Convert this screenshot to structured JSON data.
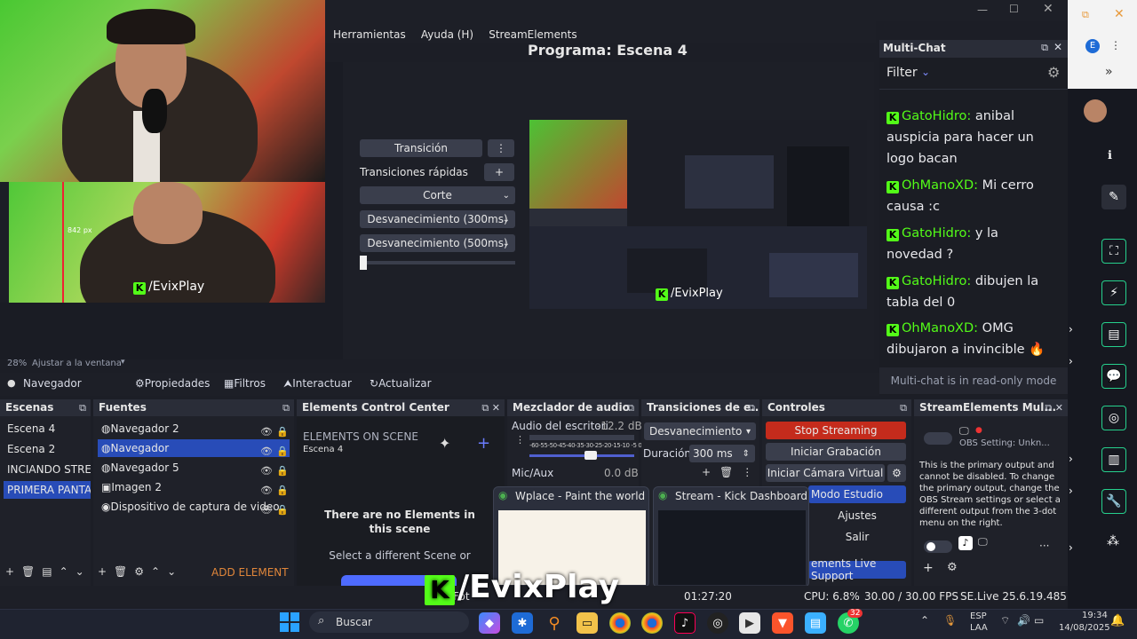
{
  "menu": [
    "Herramientas",
    "Ayuda (H)",
    "StreamElements"
  ],
  "preview": {
    "zoom_label": "28%",
    "fit_label": "Ajustar a la ventana",
    "px_label": "842 px",
    "overlay_name": "/EvixPlay"
  },
  "program": {
    "title": "Programa: Escena 4",
    "overlay_name": "/EvixPlay"
  },
  "transitions": {
    "main_label": "Transición",
    "quick_label": "Transiciones rápidas",
    "items": [
      "Corte",
      "Desvanecimiento (300ms)",
      "Desvanecimiento (500ms)"
    ]
  },
  "multichat": {
    "title": "Multi-Chat",
    "filter_label": "Filter",
    "footer": "Multi-chat is in read-only mode",
    "messages": [
      {
        "user": "GatoHidro:",
        "text": " anibal auspicia para hacer un logo bacan"
      },
      {
        "user": "OhManoXD:",
        "text": " Mi cerro causa :c"
      },
      {
        "user": "GatoHidro:",
        "text": " y la novedad ?"
      },
      {
        "user": "GatoHidro:",
        "text": " dibujen la tabla del 0"
      },
      {
        "user": "OhManoXD:",
        "text": " OMG dibujaron a invincible 🔥"
      }
    ]
  },
  "source_toolbar": {
    "source": "Navegador",
    "props": "Propiedades",
    "filters": "Filtros",
    "interact": "Interactuar",
    "refresh": "Actualizar"
  },
  "scenes": {
    "title": "Escenas",
    "items": [
      "Escena 4",
      "Escena 2",
      "INCIANDO STREA",
      "PRIMERA PANTAL"
    ]
  },
  "sources": {
    "title": "Fuentes",
    "items": [
      "Navegador 2",
      "Navegador",
      "Navegador 5",
      "Imagen 2",
      "Dispositivo de captura de video"
    ]
  },
  "elements": {
    "title": "Elements Control Center",
    "on_scene": "ELEMENTS ON SCENE",
    "scene": "Escena 4",
    "empty_title": "There are no Elements in this scene",
    "empty_sub": "Select a different Scene or",
    "add": "ADD ELEMENT"
  },
  "mixer": {
    "title": "Mezclador de audio",
    "ch1": "Audio del escritori",
    "ch1_db": "-12.2 dB",
    "ch2": "Mic/Aux",
    "ch2_db": "0.0 dB",
    "scale": "-60-55-50-45-40-35-30-25-20-15-10 -5 0"
  },
  "scene_trans": {
    "title": "Transiciones de e...",
    "type": "Desvanecimiento",
    "dur_label": "Duración",
    "dur": "300 ms"
  },
  "controls": {
    "title": "Controles",
    "stream": "Stop Streaming",
    "record": "Iniciar Grabación",
    "vcam": "Iniciar Cámara Virtual",
    "studio": "Modo Estudio",
    "settings": "Ajustes",
    "exit": "Salir"
  },
  "se_live": {
    "title": "StreamElements Mul...",
    "setting": "OBS Setting: Unkn...",
    "desc": "This is the primary output and cannot be disabled. To change the primary output, change the OBS Stream settings or select a different output from the 3-dot menu on the right.",
    "support": "ements Live Support"
  },
  "thumbs": [
    {
      "title": "Wplace - Paint the world -..."
    },
    {
      "title": "Stream - Kick Dashboard -..."
    }
  ],
  "status": {
    "time": "01:27:20",
    "cpu": "CPU: 6.8%",
    "fps": "30.00 / 30.00 FPS",
    "version": "SE.Live 25.6.19.485",
    "prefix": "Fot"
  },
  "watermark": "/EvixPlay",
  "taskbar": {
    "search": "Buscar",
    "lang": "ESP",
    "region": "LAA",
    "time": "19:34",
    "date": "14/08/2025",
    "badge": "32"
  },
  "colors": {
    "accent": "#284cb8",
    "kick": "#53fc18",
    "stop": "#c42b1c"
  },
  "sidebar_avatar": "E"
}
